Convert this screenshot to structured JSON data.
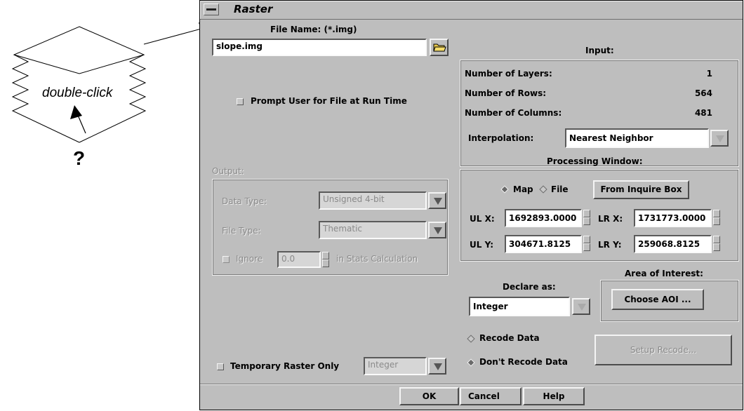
{
  "annotation": {
    "icon_label": "double-click",
    "question_mark": "?"
  },
  "window": {
    "title": "Raster"
  },
  "file": {
    "label": "File Name: (*.img)",
    "value": "slope.img",
    "prompt_label": "Prompt User for File at Run Time"
  },
  "output": {
    "label": "Output:",
    "data_type_label": "Data Type:",
    "data_type_value": "Unsigned 4-bit",
    "file_type_label": "File Type:",
    "file_type_value": "Thematic",
    "ignore_label": "Ignore",
    "ignore_value": "0.0",
    "stats_label": "in Stats Calculation"
  },
  "temp": {
    "label": "Temporary Raster Only",
    "value": "Integer"
  },
  "input": {
    "label": "Input:",
    "layers_label": "Number of Layers:",
    "layers_value": "1",
    "rows_label": "Number of Rows:",
    "rows_value": "564",
    "cols_label": "Number of Columns:",
    "cols_value": "481",
    "interp_label": "Interpolation:",
    "interp_value": "Nearest Neighbor"
  },
  "processing": {
    "label": "Processing Window:",
    "map_label": "Map",
    "file_label": "File",
    "inquire_button": "From Inquire Box",
    "ulx_label": "UL X:",
    "ulx_value": "1692893.0000",
    "lrx_label": "LR X:",
    "lrx_value": "1731773.0000",
    "uly_label": "UL Y:",
    "uly_value": "304671.8125",
    "lry_label": "LR Y:",
    "lry_value": "259068.8125"
  },
  "aoi": {
    "label": "Area of Interest:",
    "button": "Choose AOI ..."
  },
  "declare": {
    "label": "Declare as:",
    "value": "Integer"
  },
  "recode": {
    "recode_label": "Recode Data",
    "no_recode_label": "Don't Recode Data",
    "setup_button": "Setup Recode..."
  },
  "buttons": {
    "ok": "OK",
    "cancel": "Cancel",
    "help": "Help"
  }
}
